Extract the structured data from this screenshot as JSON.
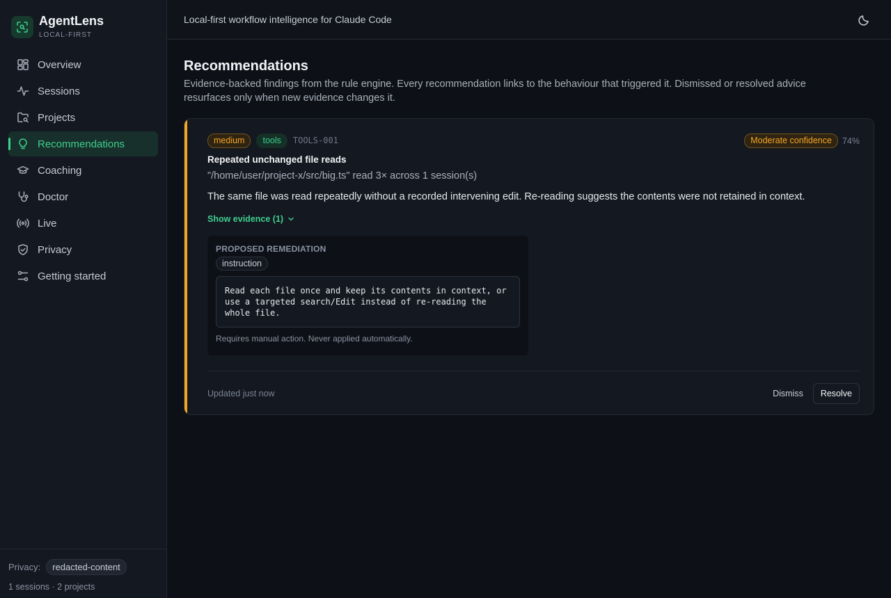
{
  "app": {
    "name": "AgentLens",
    "subtitle": "LOCAL-FIRST",
    "tagline": "Local-first workflow intelligence for Claude Code"
  },
  "colors": {
    "accent": "#3ecf8e",
    "warning": "#f5a524",
    "background": "#0d1016"
  },
  "sidebar": {
    "items": [
      {
        "label": "Overview",
        "icon": "overview-icon",
        "active": false
      },
      {
        "label": "Sessions",
        "icon": "activity-icon",
        "active": false
      },
      {
        "label": "Projects",
        "icon": "folder-search-icon",
        "active": false
      },
      {
        "label": "Recommendations",
        "icon": "lightbulb-icon",
        "active": true
      },
      {
        "label": "Coaching",
        "icon": "graduation-cap-icon",
        "active": false
      },
      {
        "label": "Doctor",
        "icon": "stethoscope-icon",
        "active": false
      },
      {
        "label": "Live",
        "icon": "broadcast-icon",
        "active": false
      },
      {
        "label": "Privacy",
        "icon": "shield-check-icon",
        "active": false
      },
      {
        "label": "Getting started",
        "icon": "sliders-icon",
        "active": false
      }
    ],
    "footer": {
      "privacy_label": "Privacy:",
      "privacy_mode": "redacted-content",
      "stats": "1 sessions · 2 projects"
    }
  },
  "page": {
    "title": "Recommendations",
    "description": "Evidence-backed findings from the rule engine. Every recommendation links to the behaviour that triggered it. Dismissed or resolved advice resurfaces only when new evidence changes it."
  },
  "recommendation": {
    "severity": "medium",
    "category": "tools",
    "rule_id": "TOOLS-001",
    "confidence_label": "Moderate confidence",
    "confidence_pct": "74%",
    "title": "Repeated unchanged file reads",
    "summary": "\"/home/user/project-x/src/big.ts\" read 3× across 1 session(s)",
    "body": "The same file was read repeatedly without a recorded intervening edit. Re-reading suggests the contents were not retained in context.",
    "evidence_toggle": "Show evidence (1)",
    "remediation": {
      "heading": "PROPOSED REMEDIATION",
      "type": "instruction",
      "text": "Read each file once and keep its contents in context, or use a targeted search/Edit instead of re-reading the whole file.",
      "note": "Requires manual action. Never applied automatically."
    },
    "updated": "Updated just now",
    "dismiss_label": "Dismiss",
    "resolve_label": "Resolve"
  }
}
